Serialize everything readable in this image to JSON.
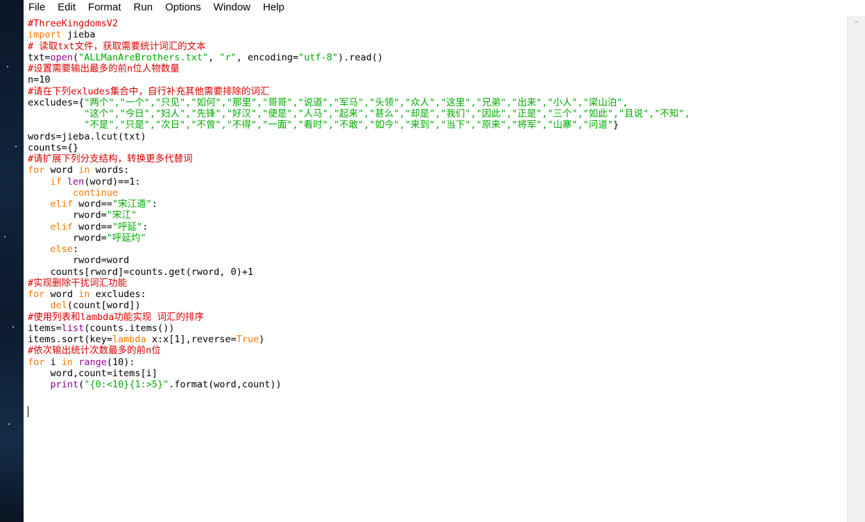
{
  "menu": [
    "File",
    "Edit",
    "Format",
    "Run",
    "Options",
    "Window",
    "Help"
  ],
  "code": [
    [
      {
        "t": "#ThreeKingdomsV2",
        "c": "comment"
      }
    ],
    [
      {
        "t": "import",
        "c": "kw"
      },
      {
        "t": " jieba",
        "c": ""
      }
    ],
    [
      {
        "t": "# 读取txt文件，获取需要统计词汇的文本",
        "c": "comment"
      }
    ],
    [
      {
        "t": "txt=",
        "c": ""
      },
      {
        "t": "open",
        "c": "bi"
      },
      {
        "t": "(",
        "c": ""
      },
      {
        "t": "\"ALLManAreBrothers.txt\"",
        "c": "str"
      },
      {
        "t": ", ",
        "c": ""
      },
      {
        "t": "\"r\"",
        "c": "str"
      },
      {
        "t": ", encoding=",
        "c": ""
      },
      {
        "t": "\"utf-8\"",
        "c": "str"
      },
      {
        "t": ").read()",
        "c": ""
      }
    ],
    [
      {
        "t": "#设置需要输出最多的前n位人物数量",
        "c": "comment"
      }
    ],
    [
      {
        "t": "n=10",
        "c": ""
      }
    ],
    [
      {
        "t": "#请在下列exludes集合中，自行补充其他需要排除的词汇",
        "c": "comment"
      }
    ],
    [
      {
        "t": "excludes={",
        "c": ""
      },
      {
        "t": "\"两个\",\"一个\",\"只见\",\"如何\",\"那里\",\"哥哥\",\"说道\",\"军马\",\"头领\",\"众人\",\"这里\",\"兄弟\",\"出来\",\"小人\",\"梁山泊\",",
        "c": "str"
      }
    ],
    [
      {
        "t": "          \"这个\",\"今日\",\"妇人\",\"先锋\",\"好汉\",\"便是\",\"人马\",\"起来\",\"甚么\",\"却是\",\"我们\",\"因此\",\"正是\",\"三个\",\"如此\",\"且说\",\"不知\",",
        "c": "str"
      }
    ],
    [
      {
        "t": "          \"不是\",\"只是\",\"次日\",\"不曾\",\"不得\",\"一面\",\"看时\",\"不敢\",\"如今\",\"来到\",\"当下\",\"原来\",\"将军\",\"山寨\",\"问道\"",
        "c": "str"
      },
      {
        "t": "}",
        "c": ""
      }
    ],
    [
      {
        "t": "words=jieba.lcut(txt)",
        "c": ""
      }
    ],
    [
      {
        "t": "counts={}",
        "c": ""
      }
    ],
    [
      {
        "t": "#请扩展下列分支结构，转换更多代替词",
        "c": "comment"
      }
    ],
    [
      {
        "t": "for",
        "c": "kw"
      },
      {
        "t": " word ",
        "c": ""
      },
      {
        "t": "in",
        "c": "kw"
      },
      {
        "t": " words:",
        "c": ""
      }
    ],
    [
      {
        "t": "    ",
        "c": ""
      },
      {
        "t": "if",
        "c": "kw"
      },
      {
        "t": " ",
        "c": ""
      },
      {
        "t": "len",
        "c": "bi"
      },
      {
        "t": "(word)==1:",
        "c": ""
      }
    ],
    [
      {
        "t": "        ",
        "c": ""
      },
      {
        "t": "continue",
        "c": "kw"
      }
    ],
    [
      {
        "t": "    ",
        "c": ""
      },
      {
        "t": "elif",
        "c": "kw"
      },
      {
        "t": " word==",
        "c": ""
      },
      {
        "t": "\"宋江道\"",
        "c": "str"
      },
      {
        "t": ":",
        "c": ""
      }
    ],
    [
      {
        "t": "        rword=",
        "c": ""
      },
      {
        "t": "\"宋江\"",
        "c": "str"
      }
    ],
    [
      {
        "t": "    ",
        "c": ""
      },
      {
        "t": "elif",
        "c": "kw"
      },
      {
        "t": " word==",
        "c": ""
      },
      {
        "t": "\"呼延\"",
        "c": "str"
      },
      {
        "t": ":",
        "c": ""
      }
    ],
    [
      {
        "t": "        rword=",
        "c": ""
      },
      {
        "t": "\"呼延灼\"",
        "c": "str"
      }
    ],
    [
      {
        "t": "    ",
        "c": ""
      },
      {
        "t": "else",
        "c": "kw"
      },
      {
        "t": ":",
        "c": ""
      }
    ],
    [
      {
        "t": "        rword=word",
        "c": ""
      }
    ],
    [
      {
        "t": "    counts[rword]=counts.get(rword, 0)+1",
        "c": ""
      }
    ],
    [
      {
        "t": "#实现删除干扰词汇功能",
        "c": "comment"
      }
    ],
    [
      {
        "t": "for",
        "c": "kw"
      },
      {
        "t": " word ",
        "c": ""
      },
      {
        "t": "in",
        "c": "kw"
      },
      {
        "t": " excludes:",
        "c": ""
      }
    ],
    [
      {
        "t": "    ",
        "c": ""
      },
      {
        "t": "del",
        "c": "kw"
      },
      {
        "t": "(count[word])",
        "c": ""
      }
    ],
    [
      {
        "t": "#使用列表和lambda功能实现 词汇的排序",
        "c": "comment"
      }
    ],
    [
      {
        "t": "items=",
        "c": ""
      },
      {
        "t": "list",
        "c": "bi"
      },
      {
        "t": "(counts.items())",
        "c": ""
      }
    ],
    [
      {
        "t": "items.sort(key=",
        "c": ""
      },
      {
        "t": "lambda",
        "c": "kw"
      },
      {
        "t": " x:x[1],reverse=",
        "c": ""
      },
      {
        "t": "True",
        "c": "kw"
      },
      {
        "t": ")",
        "c": ""
      }
    ],
    [
      {
        "t": "#依次输出统计次数最多的前n位",
        "c": "comment"
      }
    ],
    [
      {
        "t": "for",
        "c": "kw"
      },
      {
        "t": " i ",
        "c": ""
      },
      {
        "t": "in",
        "c": "kw"
      },
      {
        "t": " ",
        "c": ""
      },
      {
        "t": "range",
        "c": "bi"
      },
      {
        "t": "(10):",
        "c": ""
      }
    ],
    [
      {
        "t": "    word,count=items[i]",
        "c": ""
      }
    ],
    [
      {
        "t": "    ",
        "c": ""
      },
      {
        "t": "print",
        "c": "bi"
      },
      {
        "t": "(",
        "c": ""
      },
      {
        "t": "\"{0:<10}{1:>5}\"",
        "c": "str"
      },
      {
        "t": ".format(word,count))",
        "c": ""
      }
    ]
  ],
  "scrollbar": {
    "up_icon": "chevron-up-icon"
  }
}
